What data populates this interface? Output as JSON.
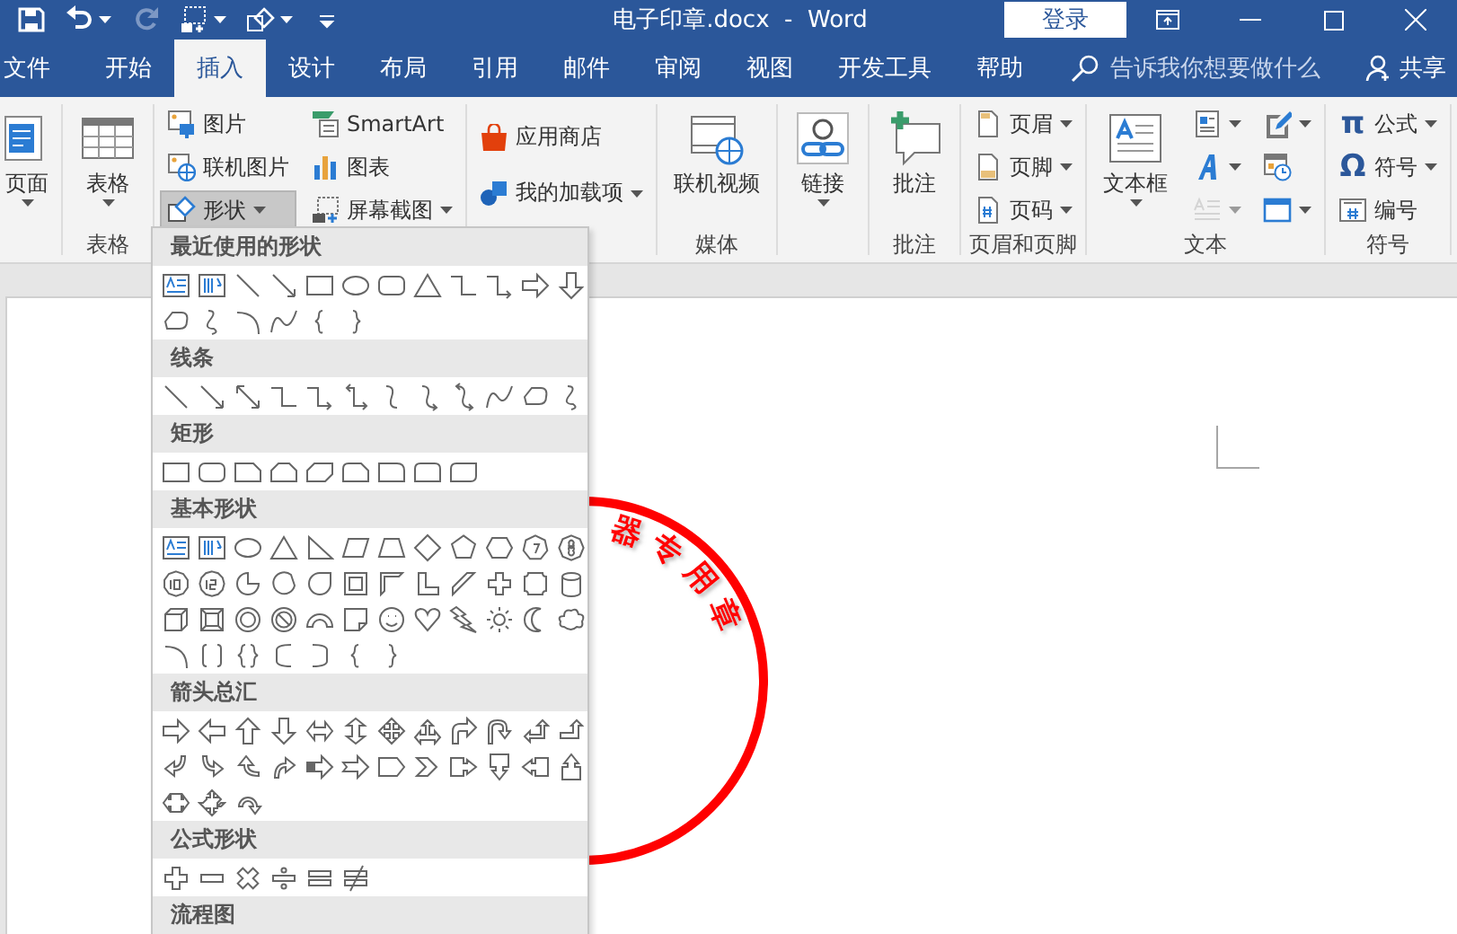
{
  "title_bar": {
    "quick_access": [
      {
        "dropdown": false,
        "disabled": false
      },
      {
        "dropdown": true,
        "disabled": false
      },
      {
        "dropdown": false,
        "disabled": true
      },
      {
        "dropdown": true,
        "disabled": false
      },
      {
        "dropdown": true,
        "disabled": false
      },
      {
        "dropdown": false,
        "disabled": false
      }
    ],
    "title": "电子印章.docx  -  Word",
    "sign_in": "登录"
  },
  "tabs": [
    {
      "label": "文件",
      "selected": false
    },
    {
      "label": "开始",
      "selected": false
    },
    {
      "label": "插入",
      "selected": true
    },
    {
      "label": "设计",
      "selected": false
    },
    {
      "label": "布局",
      "selected": false
    },
    {
      "label": "引用",
      "selected": false
    },
    {
      "label": "邮件",
      "selected": false
    },
    {
      "label": "审阅",
      "selected": false
    },
    {
      "label": "视图",
      "selected": false
    },
    {
      "label": "开发工具",
      "selected": false
    },
    {
      "label": "帮助",
      "selected": false
    }
  ],
  "search": {
    "placeholder": "告诉我你想要做什么"
  },
  "share": "共享",
  "ribbon": {
    "groups": [
      {
        "columns": [
          [
            {
              "kind": "large",
              "label": "页面",
              "dropdown": true,
              "pressed": false,
              "disabled": false
            }
          ]
        ]
      },
      {
        "label": "表格",
        "columns": [
          [
            {
              "kind": "large",
              "label": "表格",
              "dropdown": true,
              "pressed": false,
              "disabled": false
            }
          ]
        ]
      },
      {
        "columns": [
          [
            {
              "kind": "small",
              "label": "图片",
              "dropdown": false,
              "pressed": false,
              "disabled": false
            },
            {
              "kind": "small",
              "label": "联机图片",
              "dropdown": false,
              "pressed": false,
              "disabled": false
            },
            {
              "kind": "small",
              "label": "形状",
              "dropdown": true,
              "pressed": true,
              "disabled": false
            }
          ],
          [
            {
              "kind": "small",
              "label": "SmartArt",
              "dropdown": false,
              "pressed": false,
              "disabled": false
            },
            {
              "kind": "small",
              "label": "图表",
              "dropdown": false,
              "pressed": false,
              "disabled": false
            },
            {
              "kind": "small",
              "label": "屏幕截图",
              "dropdown": true,
              "pressed": false,
              "disabled": false
            }
          ]
        ]
      },
      {
        "columns": [
          [
            {
              "kind": "small",
              "label": "应用商店",
              "dropdown": false,
              "pressed": false,
              "disabled": false
            },
            {
              "kind": "small",
              "label": "我的加载项",
              "dropdown": true,
              "pressed": false,
              "disabled": false
            }
          ]
        ]
      },
      {
        "label": "媒体",
        "columns": [
          [
            {
              "kind": "large",
              "label": "联机视频",
              "dropdown": false,
              "pressed": false,
              "disabled": false
            }
          ]
        ]
      },
      {
        "columns": [
          [
            {
              "kind": "large",
              "label": "链接",
              "dropdown": true,
              "pressed": false,
              "disabled": false
            }
          ]
        ]
      },
      {
        "label": "批注",
        "columns": [
          [
            {
              "kind": "large",
              "label": "批注",
              "dropdown": false,
              "pressed": false,
              "disabled": false
            }
          ]
        ]
      },
      {
        "label": "页眉和页脚",
        "columns": [
          [
            {
              "kind": "small",
              "label": "页眉",
              "dropdown": true,
              "pressed": false,
              "disabled": false
            },
            {
              "kind": "small",
              "label": "页脚",
              "dropdown": true,
              "pressed": false,
              "disabled": false
            },
            {
              "kind": "small",
              "label": "页码",
              "dropdown": true,
              "pressed": false,
              "disabled": false
            }
          ]
        ]
      },
      {
        "label": "文本",
        "columns": [
          [
            {
              "kind": "large",
              "label": "文本框",
              "dropdown": true,
              "pressed": false,
              "disabled": false
            }
          ],
          [
            {
              "kind": "icon",
              "dropdown": true,
              "pressed": false,
              "disabled": false
            },
            {
              "kind": "icon",
              "dropdown": true,
              "pressed": false,
              "disabled": false
            },
            {
              "kind": "icon",
              "dropdown": true,
              "pressed": false,
              "disabled": true
            }
          ],
          [
            {
              "kind": "icon",
              "dropdown": true,
              "pressed": false,
              "disabled": false
            },
            {
              "kind": "icon",
              "dropdown": false,
              "pressed": false,
              "disabled": false
            },
            {
              "kind": "icon",
              "dropdown": true,
              "pressed": false,
              "disabled": false
            }
          ]
        ]
      },
      {
        "label": "符号",
        "columns": [
          [
            {
              "kind": "glyph",
              "glyph": "π",
              "label": "公式",
              "dropdown": true,
              "pressed": false,
              "disabled": false
            },
            {
              "kind": "glyph",
              "glyph": "Ω",
              "label": "符号",
              "dropdown": true,
              "pressed": false,
              "disabled": false
            },
            {
              "kind": "small",
              "label": "编号",
              "dropdown": false,
              "pressed": false,
              "disabled": false
            }
          ]
        ]
      }
    ]
  },
  "document": {
    "stamp_text": "器专用章"
  },
  "shapes_gallery": {
    "sections": [
      {
        "title": "最近使用的形状"
      },
      {
        "title": "线条"
      },
      {
        "title": "矩形"
      },
      {
        "title": "基本形状"
      },
      {
        "title": "箭头总汇"
      },
      {
        "title": "公式形状"
      },
      {
        "title": "流程图"
      }
    ]
  }
}
